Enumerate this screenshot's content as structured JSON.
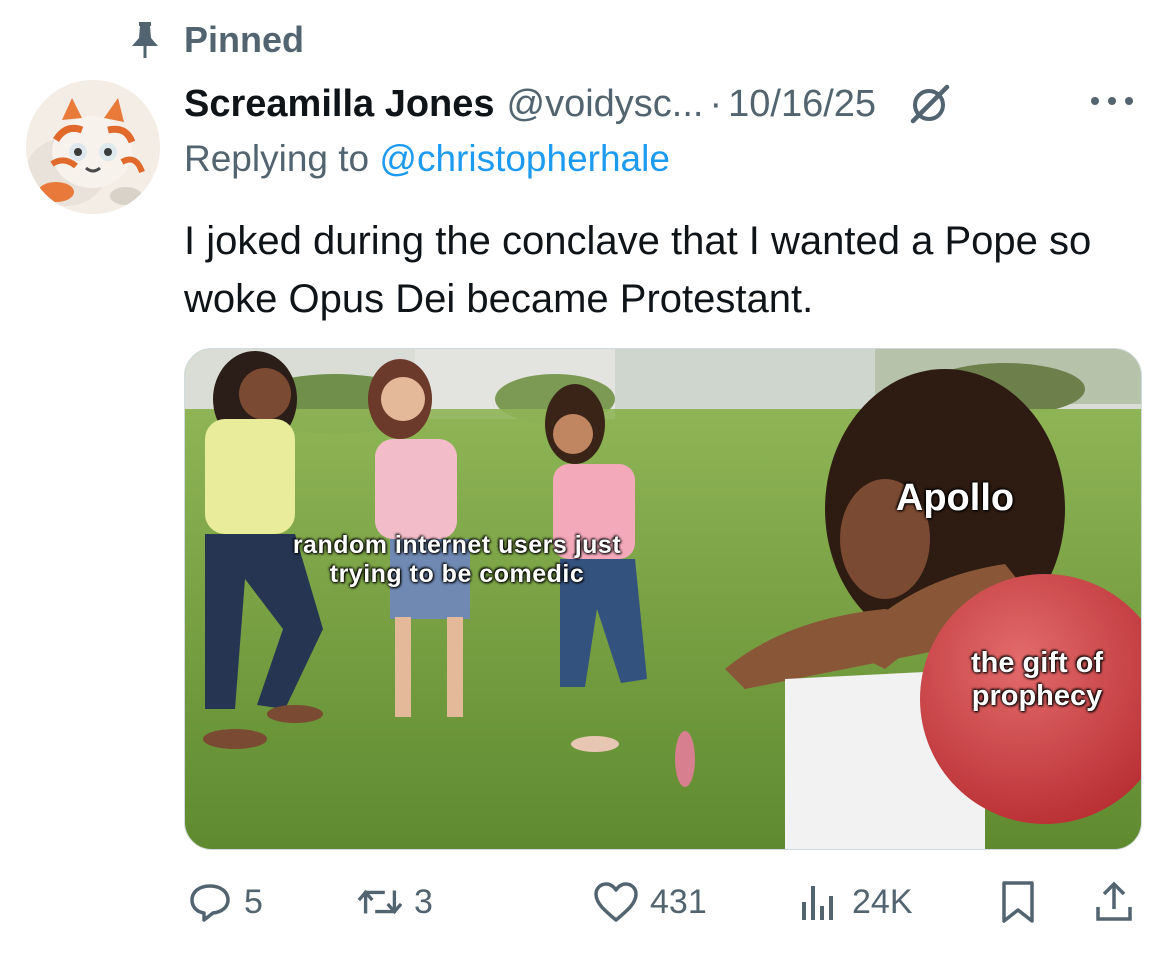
{
  "pinned": {
    "label": "Pinned",
    "icon": "pin-icon"
  },
  "author": {
    "display_name": "Screamilla Jones",
    "handle": "@voidysc...",
    "separator": "·",
    "date": "10/16/25"
  },
  "reply": {
    "prefix": "Replying to ",
    "mention": "@christopherhale"
  },
  "tweet": {
    "text": "I joked during the conclave that I wanted a Pope so woke Opus Dei became Protestant."
  },
  "media": {
    "labels": {
      "left": "random internet users just trying to be comedic",
      "apollo": "Apollo",
      "ball": "the gift of prophecy"
    }
  },
  "actions": {
    "replies": "5",
    "reposts": "3",
    "likes": "431",
    "views": "24K"
  },
  "colors": {
    "accent": "#1d9bf0",
    "secondary_text": "#536471",
    "primary_text": "#0f1419"
  }
}
